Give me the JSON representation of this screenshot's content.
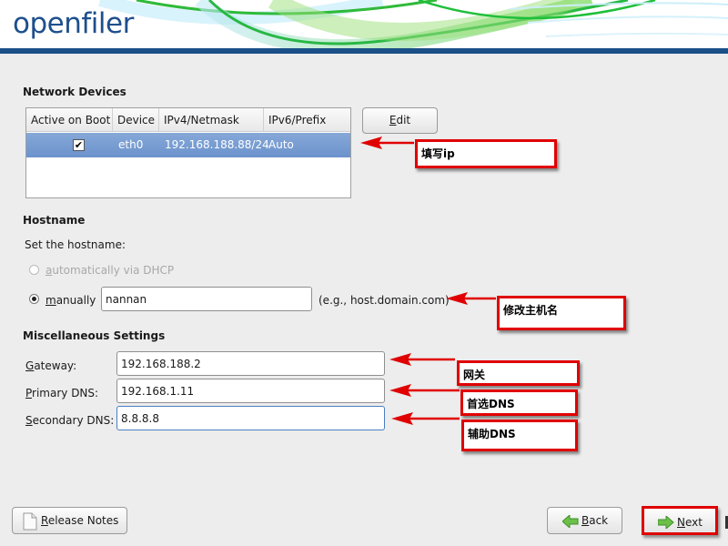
{
  "header": {
    "logo_text": "openfiler",
    "bar_color": "#1b5088"
  },
  "network_devices": {
    "title": "Network Devices",
    "columns": [
      "Active on Boot",
      "Device",
      "IPv4/Netmask",
      "IPv6/Prefix"
    ],
    "rows": [
      {
        "active_on_boot": true,
        "active_glyph": "✔",
        "device": "eth0",
        "ipv4": "192.168.188.88/24",
        "ipv6": "Auto",
        "selected": true
      }
    ],
    "edit_button": {
      "label_prefix": "E",
      "label_rest": "dit"
    }
  },
  "hostname": {
    "title": "Hostname",
    "prompt": "Set the hostname:",
    "options": [
      {
        "mnemonic": "a",
        "rest": "utomatically via DHCP",
        "selected": false,
        "disabled": true
      },
      {
        "mnemonic": "m",
        "rest": "anually",
        "selected": true,
        "disabled": false
      }
    ],
    "value": "nannan",
    "example": "(e.g., host.domain.com)"
  },
  "misc": {
    "title": "Miscellaneous Settings",
    "fields": [
      {
        "mnemonic": "G",
        "rest": "ateway:",
        "value": "192.168.188.2"
      },
      {
        "mnemonic": "P",
        "rest": "rimary DNS:",
        "value": "192.168.1.11"
      },
      {
        "mnemonic": "S",
        "rest": "econdary DNS:",
        "value": "8.8.8.8"
      }
    ]
  },
  "annotations": {
    "fill_ip": "填写ip",
    "change_hostname": "修改主机名",
    "gateway": "网关",
    "primary_dns": "首选DNS",
    "secondary_dns": "辅助DNS",
    "color": "#e00000"
  },
  "footer": {
    "release_notes": {
      "mnemonic": "R",
      "rest": "elease Notes"
    },
    "back": {
      "mnemonic": "B",
      "rest": "ack"
    },
    "next": {
      "mnemonic": "N",
      "rest": "ext"
    }
  }
}
